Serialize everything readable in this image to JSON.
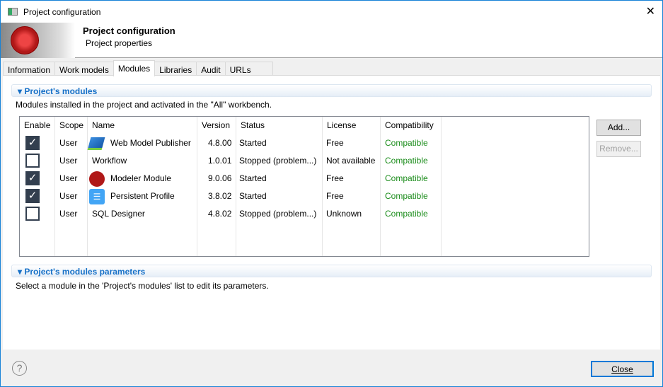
{
  "window": {
    "title": "Project configuration"
  },
  "header": {
    "title": "Project configuration",
    "subtitle": "Project properties"
  },
  "tabs": [
    {
      "label": "Information"
    },
    {
      "label": "Work models"
    },
    {
      "label": "Modules",
      "active": true
    },
    {
      "label": "Libraries"
    },
    {
      "label": "Audit"
    },
    {
      "label": "URLs"
    }
  ],
  "modules_section": {
    "title": "Project's modules",
    "description": "Modules installed in the project and activated in the \"All\" workbench."
  },
  "table": {
    "columns": [
      "Enable",
      "Scope",
      "Name",
      "Version",
      "Status",
      "License",
      "Compatibility"
    ],
    "rows": [
      {
        "enabled": true,
        "scope": "User",
        "icon": "book-icon",
        "name": "Web Model Publisher",
        "version": "4.8.00",
        "status": "Started",
        "license": "Free",
        "compatibility": "Compatible"
      },
      {
        "enabled": false,
        "scope": "User",
        "icon": "",
        "name": "Workflow",
        "version": "1.0.01",
        "status": "Stopped (problem...)",
        "license": "Not available",
        "compatibility": "Compatible"
      },
      {
        "enabled": true,
        "scope": "User",
        "icon": "modeler-logo-icon",
        "name": "Modeler Module",
        "version": "9.0.06",
        "status": "Started",
        "license": "Free",
        "compatibility": "Compatible"
      },
      {
        "enabled": true,
        "scope": "User",
        "icon": "profile-icon",
        "name": "Persistent Profile",
        "version": "3.8.02",
        "status": "Started",
        "license": "Free",
        "compatibility": "Compatible"
      },
      {
        "enabled": false,
        "scope": "User",
        "icon": "",
        "name": "SQL Designer",
        "version": "4.8.02",
        "status": "Stopped (problem...)",
        "license": "Unknown",
        "compatibility": "Compatible"
      }
    ]
  },
  "buttons": {
    "add": "Add...",
    "remove": "Remove...",
    "close": "Close"
  },
  "params_section": {
    "title": "Project's modules parameters",
    "description": "Select a module in the 'Project's modules' list to edit its parameters."
  },
  "colors": {
    "accent": "#1670c7",
    "compatible": "#1a8c1a",
    "checkbox": "#333f4f"
  }
}
